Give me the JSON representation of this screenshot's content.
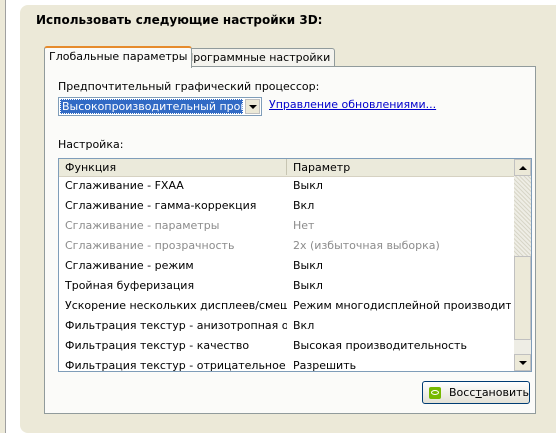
{
  "section_title": "Использовать следующие настройки 3D:",
  "tabs": [
    {
      "label": "Глобальные параметры",
      "active": true
    },
    {
      "label": "Программные настройки",
      "active": false
    }
  ],
  "processor": {
    "label": "Предпочтительный графический процессор:",
    "selected": "Высокопроизводительный процессо",
    "manage_link": "Управление обновлениями..."
  },
  "settings": {
    "label": "Настройка:",
    "columns": [
      "Функция",
      "Параметр"
    ],
    "rows": [
      {
        "feature": "Сглаживание - FXAA",
        "value": "Выкл",
        "disabled": false
      },
      {
        "feature": "Сглаживание - гамма-коррекция",
        "value": "Вкл",
        "disabled": false
      },
      {
        "feature": "Сглаживание - параметры",
        "value": "Нет",
        "disabled": true
      },
      {
        "feature": "Сглаживание - прозрачность",
        "value": "2x (избыточная выборка)",
        "disabled": true
      },
      {
        "feature": "Сглаживание - режим",
        "value": "Выкл",
        "disabled": false
      },
      {
        "feature": "Тройная буферизация",
        "value": "Выкл",
        "disabled": false
      },
      {
        "feature": "Ускорение нескольких дисплеев/смеша...",
        "value": "Режим многодисплейной производител...",
        "disabled": false
      },
      {
        "feature": "Фильтрация текстур - анизотропная оп...",
        "value": "Вкл",
        "disabled": false
      },
      {
        "feature": "Фильтрация текстур - качество",
        "value": "Высокая производительность",
        "disabled": false
      },
      {
        "feature": "Фильтрация текстур - отрицательное о...",
        "value": "Разрешить",
        "disabled": false
      }
    ]
  },
  "restore_button": "Восстановить",
  "icons": {
    "dropdown": "chevron-down-icon",
    "scroll_up": "arrow-up-icon",
    "scroll_down": "arrow-down-icon",
    "brand": "nvidia-icon"
  }
}
